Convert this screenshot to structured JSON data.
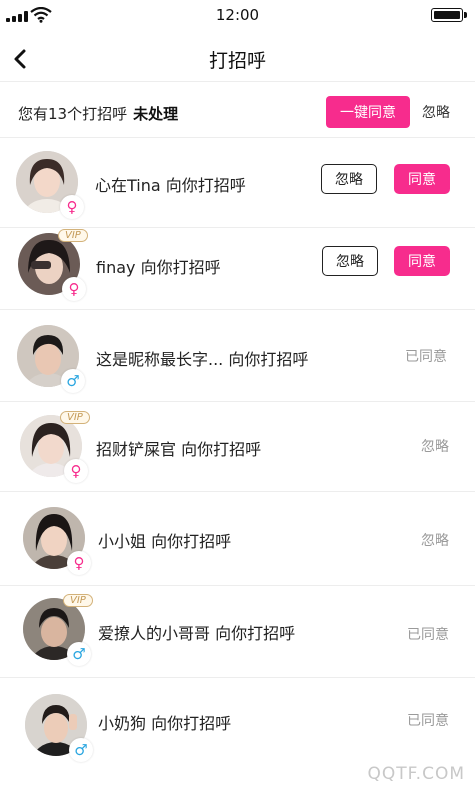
{
  "status_bar": {
    "time": "12:00"
  },
  "nav": {
    "title": "打招呼"
  },
  "summary": {
    "text": "您有13个打招呼",
    "emphasis": "未处理",
    "agree_all_label": "一键同意",
    "ignore_all_label": "忽略"
  },
  "rows": [
    {
      "message": "心在Tina 向你打招呼",
      "gender": "♀",
      "ignore_label": "忽略",
      "agree_label": "同意"
    },
    {
      "message": "finay 向你打招呼",
      "gender": "♀",
      "vip": "VIP",
      "ignore_label": "忽略",
      "agree_label": "同意"
    },
    {
      "message": "这是昵称最长字... 向你打招呼",
      "gender": "♂",
      "state": "已同意"
    },
    {
      "message": "招财铲屎官 向你打招呼",
      "gender": "♀",
      "vip": "VIP",
      "state": "忽略"
    },
    {
      "message": "小小姐 向你打招呼",
      "gender": "♀",
      "state": "忽略"
    },
    {
      "message": "爱撩人的小哥哥 向你打招呼",
      "gender": "♂",
      "vip": "VIP",
      "state": "已同意"
    },
    {
      "message": "小奶狗 向你打招呼",
      "gender": "♂",
      "state": "已同意"
    }
  ],
  "watermark": "QQTF.COM",
  "colors": {
    "accent": "#f72c8d",
    "male": "#2aa6e0",
    "vip": "#c49a57"
  }
}
